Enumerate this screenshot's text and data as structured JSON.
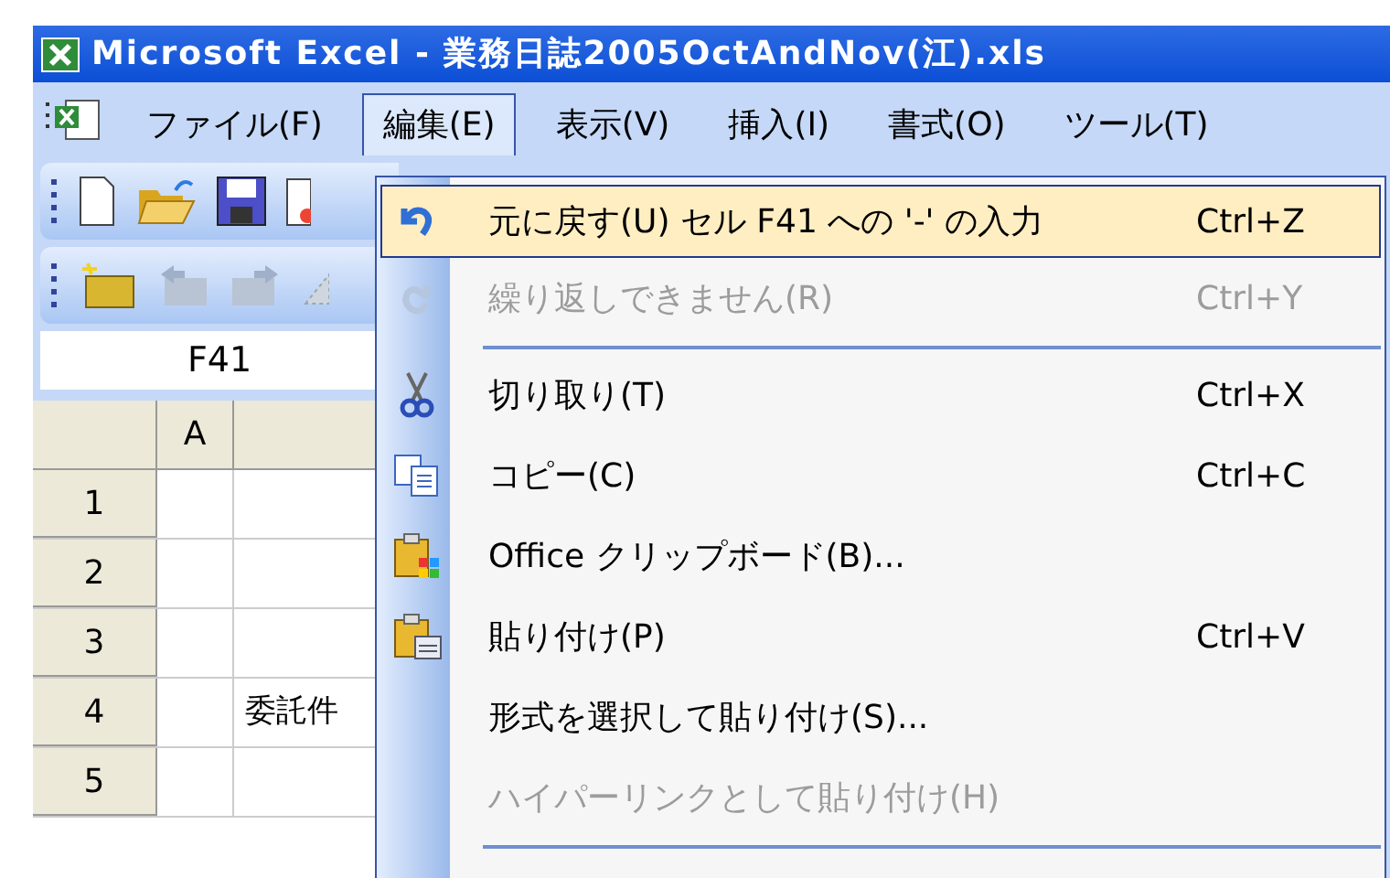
{
  "window": {
    "title": "Microsoft Excel - 業務日誌2005OctAndNov(江).xls"
  },
  "menu_bar": [
    {
      "label": "ファイル(F)",
      "selected": false
    },
    {
      "label": "編集(E)",
      "selected": true
    },
    {
      "label": "表示(V)",
      "selected": false
    },
    {
      "label": "挿入(I)",
      "selected": false
    },
    {
      "label": "書式(O)",
      "selected": false
    },
    {
      "label": "ツール(T)",
      "selected": false
    }
  ],
  "name_box": {
    "value": "F41"
  },
  "sheet": {
    "columns": [
      "A"
    ],
    "rows": [
      {
        "number": "1"
      },
      {
        "number": "2"
      },
      {
        "number": "3"
      },
      {
        "number": "4",
        "column_b": "委託件"
      },
      {
        "number": "5"
      }
    ]
  },
  "edit_menu": [
    {
      "kind": "command",
      "label": "元に戻す(U) セル F41 への '-' の入力",
      "shortcut": "Ctrl+Z",
      "disabled": false,
      "selected": true
    },
    {
      "kind": "command",
      "label": "繰り返しできません(R)",
      "shortcut": "Ctrl+Y",
      "disabled": true,
      "selected": false
    },
    {
      "kind": "separator"
    },
    {
      "kind": "command",
      "label": "切り取り(T)",
      "shortcut": "Ctrl+X",
      "disabled": false,
      "selected": false
    },
    {
      "kind": "command",
      "label": "コピー(C)",
      "shortcut": "Ctrl+C",
      "disabled": false,
      "selected": false
    },
    {
      "kind": "command",
      "label": "Office クリップボード(B)...",
      "disabled": false,
      "selected": false
    },
    {
      "kind": "command",
      "label": "貼り付け(P)",
      "shortcut": "Ctrl+V",
      "disabled": false,
      "selected": false
    },
    {
      "kind": "command",
      "label": "形式を選択して貼り付け(S)...",
      "disabled": false,
      "selected": false
    },
    {
      "kind": "command",
      "label": "ハイパーリンクとして貼り付け(H)",
      "disabled": true,
      "selected": false
    },
    {
      "kind": "separator"
    }
  ]
}
